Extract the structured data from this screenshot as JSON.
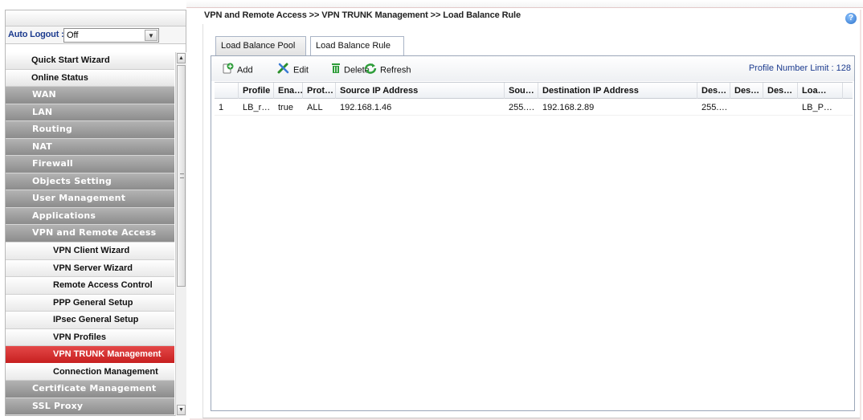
{
  "auto_logout": {
    "label": "Auto Logout :",
    "value": "Off"
  },
  "menu": [
    {
      "label": "Quick Start Wizard",
      "style": "wt"
    },
    {
      "label": "Online Status",
      "style": "wt"
    },
    {
      "label": "WAN",
      "style": "grey"
    },
    {
      "label": "LAN",
      "style": "grey"
    },
    {
      "label": "Routing",
      "style": "grey"
    },
    {
      "label": "NAT",
      "style": "grey"
    },
    {
      "label": "Firewall",
      "style": "grey"
    },
    {
      "label": "Objects Setting",
      "style": "grey"
    },
    {
      "label": "User Management",
      "style": "grey"
    },
    {
      "label": "Applications",
      "style": "grey"
    },
    {
      "label": "VPN and Remote Access",
      "style": "grey"
    },
    {
      "label": "VPN Client Wizard",
      "style": "sub"
    },
    {
      "label": "VPN Server Wizard",
      "style": "sub"
    },
    {
      "label": "Remote Access Control",
      "style": "sub"
    },
    {
      "label": "PPP General Setup",
      "style": "sub"
    },
    {
      "label": "IPsec General Setup",
      "style": "sub"
    },
    {
      "label": "VPN Profiles",
      "style": "sub"
    },
    {
      "label": "VPN TRUNK Management",
      "style": "active"
    },
    {
      "label": "Connection Management",
      "style": "sub"
    },
    {
      "label": "Certificate Management",
      "style": "grey"
    },
    {
      "label": "SSL Proxy",
      "style": "grey"
    }
  ],
  "breadcrumb": "VPN and Remote Access >> VPN TRUNK Management >> Load Balance Rule",
  "help_icon": "?",
  "tabs": {
    "pool": "Load Balance Pool",
    "rule": "Load Balance Rule"
  },
  "toolbar": {
    "add": "Add",
    "edit": "Edit",
    "delete": "Delete",
    "refresh": "Refresh",
    "profile_limit": "Profile Number Limit : 128"
  },
  "table": {
    "headers": [
      "Profile",
      "Ena…",
      "Prot…",
      "Source IP Address",
      "Sou…",
      "Destination IP Address",
      "Des…",
      "Des…",
      "Des…",
      "Loa…"
    ],
    "rows": [
      [
        "1",
        "LB_r…",
        "true",
        "ALL",
        "192.168.1.46",
        "255.…",
        "192.168.2.89",
        "255.…",
        "",
        "",
        "LB_P…"
      ]
    ]
  },
  "colors": {
    "accent": "#1d3c8f",
    "active_menu": "#d32f2f",
    "menu_grey": "#9a9a9a"
  }
}
